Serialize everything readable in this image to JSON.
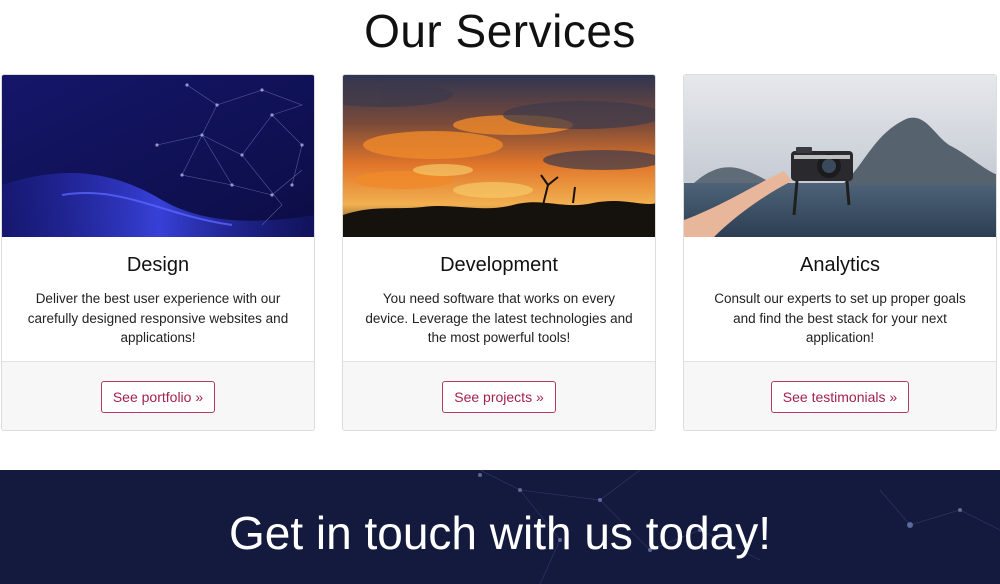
{
  "section": {
    "title": "Our Services"
  },
  "cards": [
    {
      "title": "Design",
      "text": "Deliver the best user experience with our carefully designed responsive websites and applications!",
      "button": "See portfolio »",
      "image": "network-abstract"
    },
    {
      "title": "Development",
      "text": "You need software that works on every device. Leverage the latest technologies and the most powerful tools!",
      "button": "See projects »",
      "image": "sunset-landscape"
    },
    {
      "title": "Analytics",
      "text": "Consult our experts to set up proper goals and find the best stack for your next application!",
      "button": "See testimonials »",
      "image": "camera-island"
    }
  ],
  "cta": {
    "title": "Get in touch with us today!"
  },
  "colors": {
    "accent": "#a3224f",
    "cta_bg": "#121a3c"
  }
}
